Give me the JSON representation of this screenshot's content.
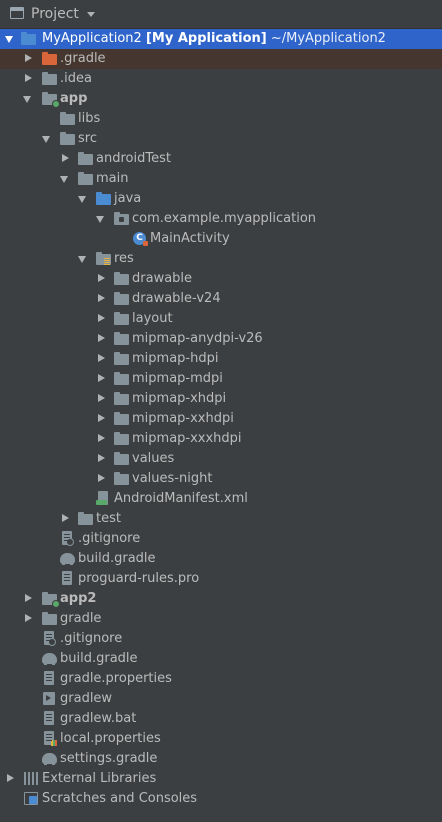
{
  "panel": {
    "title": "Project",
    "icon": "project-panel-icon",
    "dropdown_icon": "chevron-down-icon"
  },
  "colors": {
    "background": "#3c3f41",
    "selection": "#2f65ca",
    "gradle_folder_tint": "#45372f",
    "module_folder": "#4b8bd2",
    "gradle_folder": "#d9653b",
    "gray_icon": "#87939a"
  },
  "tree": {
    "root": {
      "name": "MyApplication2",
      "module": "[My Application]",
      "path": "~/MyApplication2"
    },
    "dot_gradle": ".gradle",
    "dot_idea": ".idea",
    "app": "app",
    "libs": "libs",
    "src": "src",
    "android_test": "androidTest",
    "main": "main",
    "java": "java",
    "package": "com.example.myapplication",
    "main_activity": "MainActivity",
    "res": "res",
    "res_dirs": [
      "drawable",
      "drawable-v24",
      "layout",
      "mipmap-anydpi-v26",
      "mipmap-hdpi",
      "mipmap-mdpi",
      "mipmap-xhdpi",
      "mipmap-xxhdpi",
      "mipmap-xxxhdpi",
      "values",
      "values-night"
    ],
    "manifest": "AndroidManifest.xml",
    "test": "test",
    "app_gitignore": ".gitignore",
    "app_build_gradle": "build.gradle",
    "proguard": "proguard-rules.pro",
    "app2": "app2",
    "gradle": "gradle",
    "root_gitignore": ".gitignore",
    "root_build_gradle": "build.gradle",
    "gradle_properties": "gradle.properties",
    "gradlew": "gradlew",
    "gradlew_bat": "gradlew.bat",
    "local_properties": "local.properties",
    "settings_gradle": "settings.gradle",
    "external_libraries": "External Libraries",
    "scratches": "Scratches and Consoles"
  }
}
